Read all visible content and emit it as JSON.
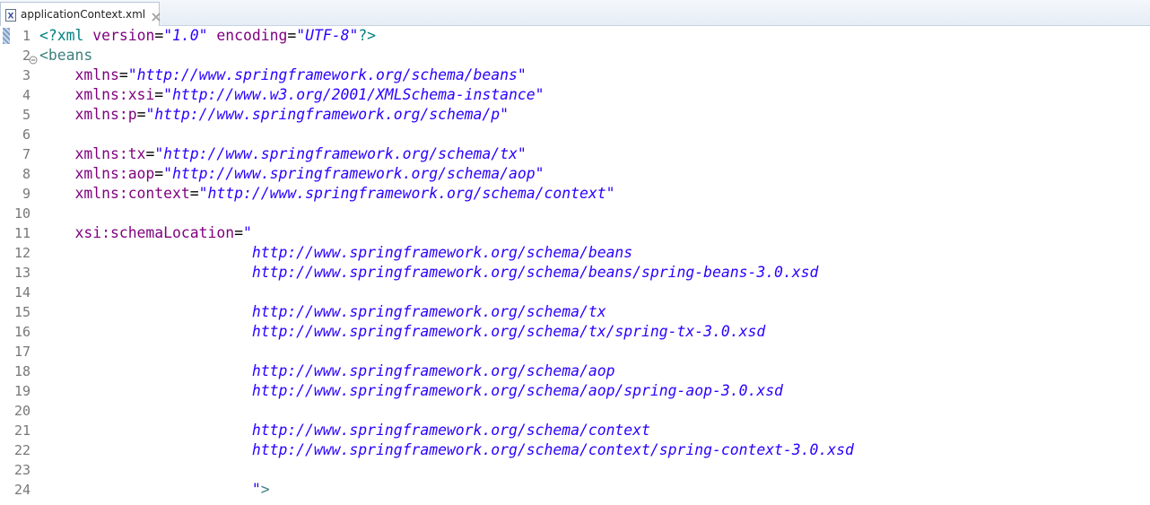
{
  "tab": {
    "label": "applicationContext.xml",
    "icon": "xml-file-icon",
    "close_icon": "close-icon"
  },
  "editor": {
    "lines": [
      {
        "num": "1",
        "tokens": [
          {
            "t": "pi",
            "v": "<?"
          },
          {
            "t": "pi",
            "v": "xml "
          },
          {
            "t": "attr",
            "v": "version"
          },
          {
            "t": "eq",
            "v": "="
          },
          {
            "t": "val",
            "v": "\"1.0\""
          },
          {
            "t": "pi",
            "v": " "
          },
          {
            "t": "attr",
            "v": "encoding"
          },
          {
            "t": "eq",
            "v": "="
          },
          {
            "t": "val",
            "v": "\"UTF-8\""
          },
          {
            "t": "pi",
            "v": "?>"
          }
        ]
      },
      {
        "num": "2",
        "fold": true,
        "tokens": [
          {
            "t": "tag",
            "v": "<beans"
          }
        ]
      },
      {
        "num": "3",
        "tokens": [
          {
            "t": "pad",
            "v": "    "
          },
          {
            "t": "attr",
            "v": "xmlns"
          },
          {
            "t": "eq",
            "v": "="
          },
          {
            "t": "val",
            "v": "\"http://www.springframework.org/schema/beans\""
          }
        ]
      },
      {
        "num": "4",
        "tokens": [
          {
            "t": "pad",
            "v": "    "
          },
          {
            "t": "attr",
            "v": "xmlns:xsi"
          },
          {
            "t": "eq",
            "v": "="
          },
          {
            "t": "val",
            "v": "\"http://www.w3.org/2001/XMLSchema-instance\""
          }
        ]
      },
      {
        "num": "5",
        "tokens": [
          {
            "t": "pad",
            "v": "    "
          },
          {
            "t": "attr",
            "v": "xmlns:p"
          },
          {
            "t": "eq",
            "v": "="
          },
          {
            "t": "val",
            "v": "\"http://www.springframework.org/schema/p\""
          }
        ]
      },
      {
        "num": "6",
        "tokens": []
      },
      {
        "num": "7",
        "tokens": [
          {
            "t": "pad",
            "v": "    "
          },
          {
            "t": "attr",
            "v": "xmlns:tx"
          },
          {
            "t": "eq",
            "v": "="
          },
          {
            "t": "val",
            "v": "\"http://www.springframework.org/schema/tx\""
          }
        ]
      },
      {
        "num": "8",
        "tokens": [
          {
            "t": "pad",
            "v": "    "
          },
          {
            "t": "attr",
            "v": "xmlns:aop"
          },
          {
            "t": "eq",
            "v": "="
          },
          {
            "t": "val",
            "v": "\"http://www.springframework.org/schema/aop\""
          }
        ]
      },
      {
        "num": "9",
        "tokens": [
          {
            "t": "pad",
            "v": "    "
          },
          {
            "t": "attr",
            "v": "xmlns:context"
          },
          {
            "t": "eq",
            "v": "="
          },
          {
            "t": "val",
            "v": "\"http://www.springframework.org/schema/context\""
          }
        ]
      },
      {
        "num": "10",
        "tokens": []
      },
      {
        "num": "11",
        "tokens": [
          {
            "t": "pad",
            "v": "    "
          },
          {
            "t": "attr",
            "v": "xsi:schemaLocation"
          },
          {
            "t": "eq",
            "v": "="
          },
          {
            "t": "val",
            "v": "\""
          }
        ]
      },
      {
        "num": "12",
        "tokens": [
          {
            "t": "pad",
            "v": "                        "
          },
          {
            "t": "val",
            "v": "http://www.springframework.org/schema/beans"
          }
        ]
      },
      {
        "num": "13",
        "tokens": [
          {
            "t": "pad",
            "v": "                        "
          },
          {
            "t": "val",
            "v": "http://www.springframework.org/schema/beans/spring-beans-3.0.xsd"
          }
        ]
      },
      {
        "num": "14",
        "tokens": []
      },
      {
        "num": "15",
        "tokens": [
          {
            "t": "pad",
            "v": "                        "
          },
          {
            "t": "val",
            "v": "http://www.springframework.org/schema/tx"
          }
        ]
      },
      {
        "num": "16",
        "tokens": [
          {
            "t": "pad",
            "v": "                        "
          },
          {
            "t": "val",
            "v": "http://www.springframework.org/schema/tx/spring-tx-3.0.xsd"
          }
        ]
      },
      {
        "num": "17",
        "tokens": []
      },
      {
        "num": "18",
        "tokens": [
          {
            "t": "pad",
            "v": "                        "
          },
          {
            "t": "val",
            "v": "http://www.springframework.org/schema/aop"
          }
        ]
      },
      {
        "num": "19",
        "tokens": [
          {
            "t": "pad",
            "v": "                        "
          },
          {
            "t": "val",
            "v": "http://www.springframework.org/schema/aop/spring-aop-3.0.xsd"
          }
        ]
      },
      {
        "num": "20",
        "tokens": []
      },
      {
        "num": "21",
        "tokens": [
          {
            "t": "pad",
            "v": "                        "
          },
          {
            "t": "val",
            "v": "http://www.springframework.org/schema/context"
          }
        ]
      },
      {
        "num": "22",
        "tokens": [
          {
            "t": "pad",
            "v": "                        "
          },
          {
            "t": "val",
            "v": "http://www.springframework.org/schema/context/spring-context-3.0.xsd"
          }
        ]
      },
      {
        "num": "23",
        "tokens": []
      },
      {
        "num": "24",
        "tokens": [
          {
            "t": "pad",
            "v": "                        "
          },
          {
            "t": "val",
            "v": "\""
          },
          {
            "t": "tag",
            "v": ">"
          }
        ]
      }
    ]
  },
  "colors": {
    "pi": "#008080",
    "tag": "#3f7f7f",
    "attr": "#7f007f",
    "value": "#2a00ff",
    "line_number": "#787878"
  }
}
